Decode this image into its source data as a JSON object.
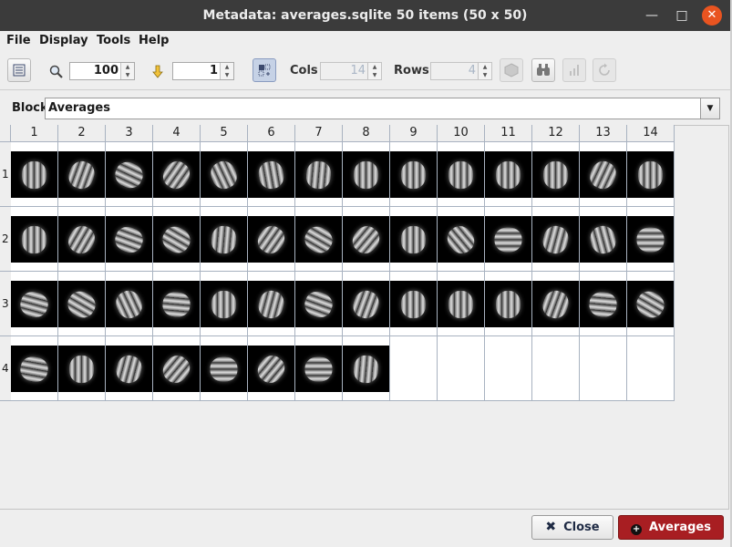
{
  "window": {
    "title": "Metadata: averages.sqlite 50 items (50 x 50)",
    "minimize": "—",
    "maximize": "□",
    "close": "✕"
  },
  "menu": [
    "File",
    "Display",
    "Tools",
    "Help"
  ],
  "toolbar": {
    "zoom_value": "100",
    "goto_value": "1",
    "cols_label": "Cols",
    "cols_value": "14",
    "rows_label": "Rows",
    "rows_value": "4"
  },
  "block": {
    "label": "Block",
    "selected": "Averages"
  },
  "grid": {
    "columns": [
      "1",
      "2",
      "3",
      "4",
      "5",
      "6",
      "7",
      "8",
      "9",
      "10",
      "11",
      "12",
      "13",
      "14"
    ],
    "rows": [
      "1",
      "2",
      "3",
      "4"
    ],
    "total_items": 50
  },
  "footer": {
    "close_label": "Close",
    "averages_label": "Averages"
  },
  "colors": {
    "accent_red": "#a81e22",
    "title_bg": "#3b3b3b",
    "close_orange": "#e95420"
  }
}
